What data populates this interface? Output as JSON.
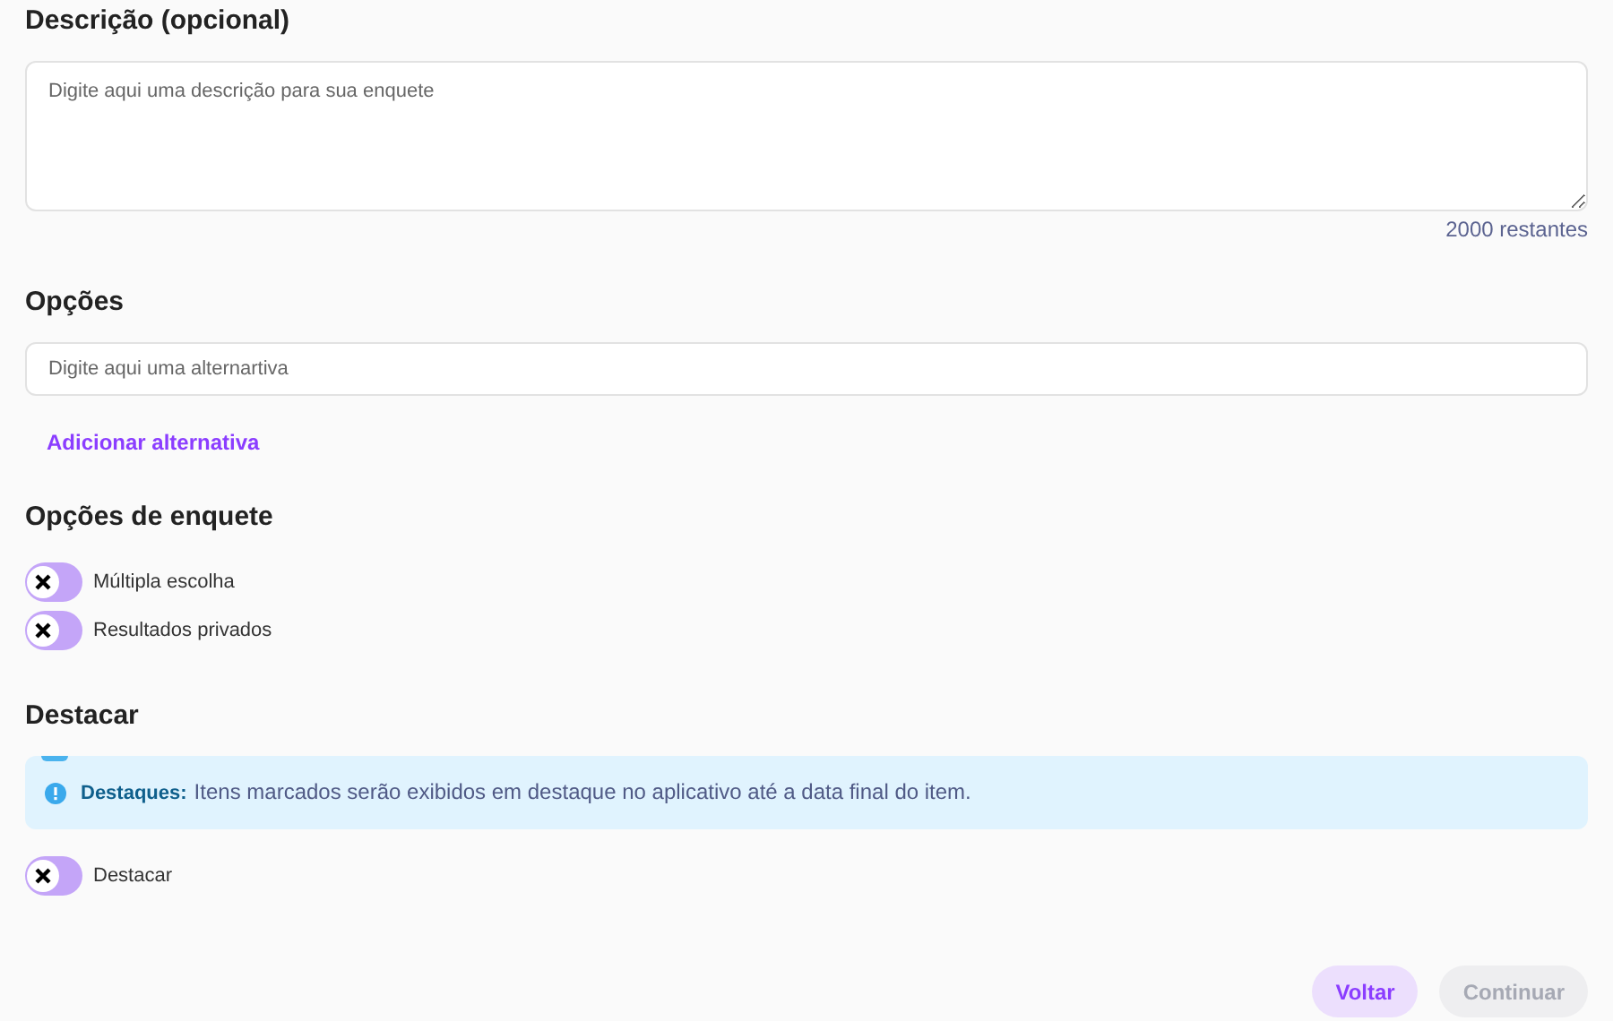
{
  "description": {
    "heading": "Descrição (opcional)",
    "placeholder": "Digite aqui uma descrição para sua enquete",
    "counter": "2000 restantes"
  },
  "options": {
    "heading": "Opções",
    "placeholder": "Digite aqui uma alternartiva",
    "add_link": "Adicionar alternativa"
  },
  "poll_options": {
    "heading": "Opções de enquete",
    "toggles": [
      {
        "label": "Múltipla escolha",
        "on": false
      },
      {
        "label": "Resultados privados",
        "on": false
      }
    ]
  },
  "highlight": {
    "heading": "Destacar",
    "alert": {
      "title": "Destaques:",
      "text": "Itens marcados serão exibidos em destaque no aplicativo até a data final do item."
    },
    "toggles": [
      {
        "label": "Destacar",
        "on": false
      }
    ]
  },
  "buttons": [
    {
      "label": "Voltar",
      "disabled": false
    },
    {
      "label": "Continuar",
      "disabled": true
    }
  ]
}
